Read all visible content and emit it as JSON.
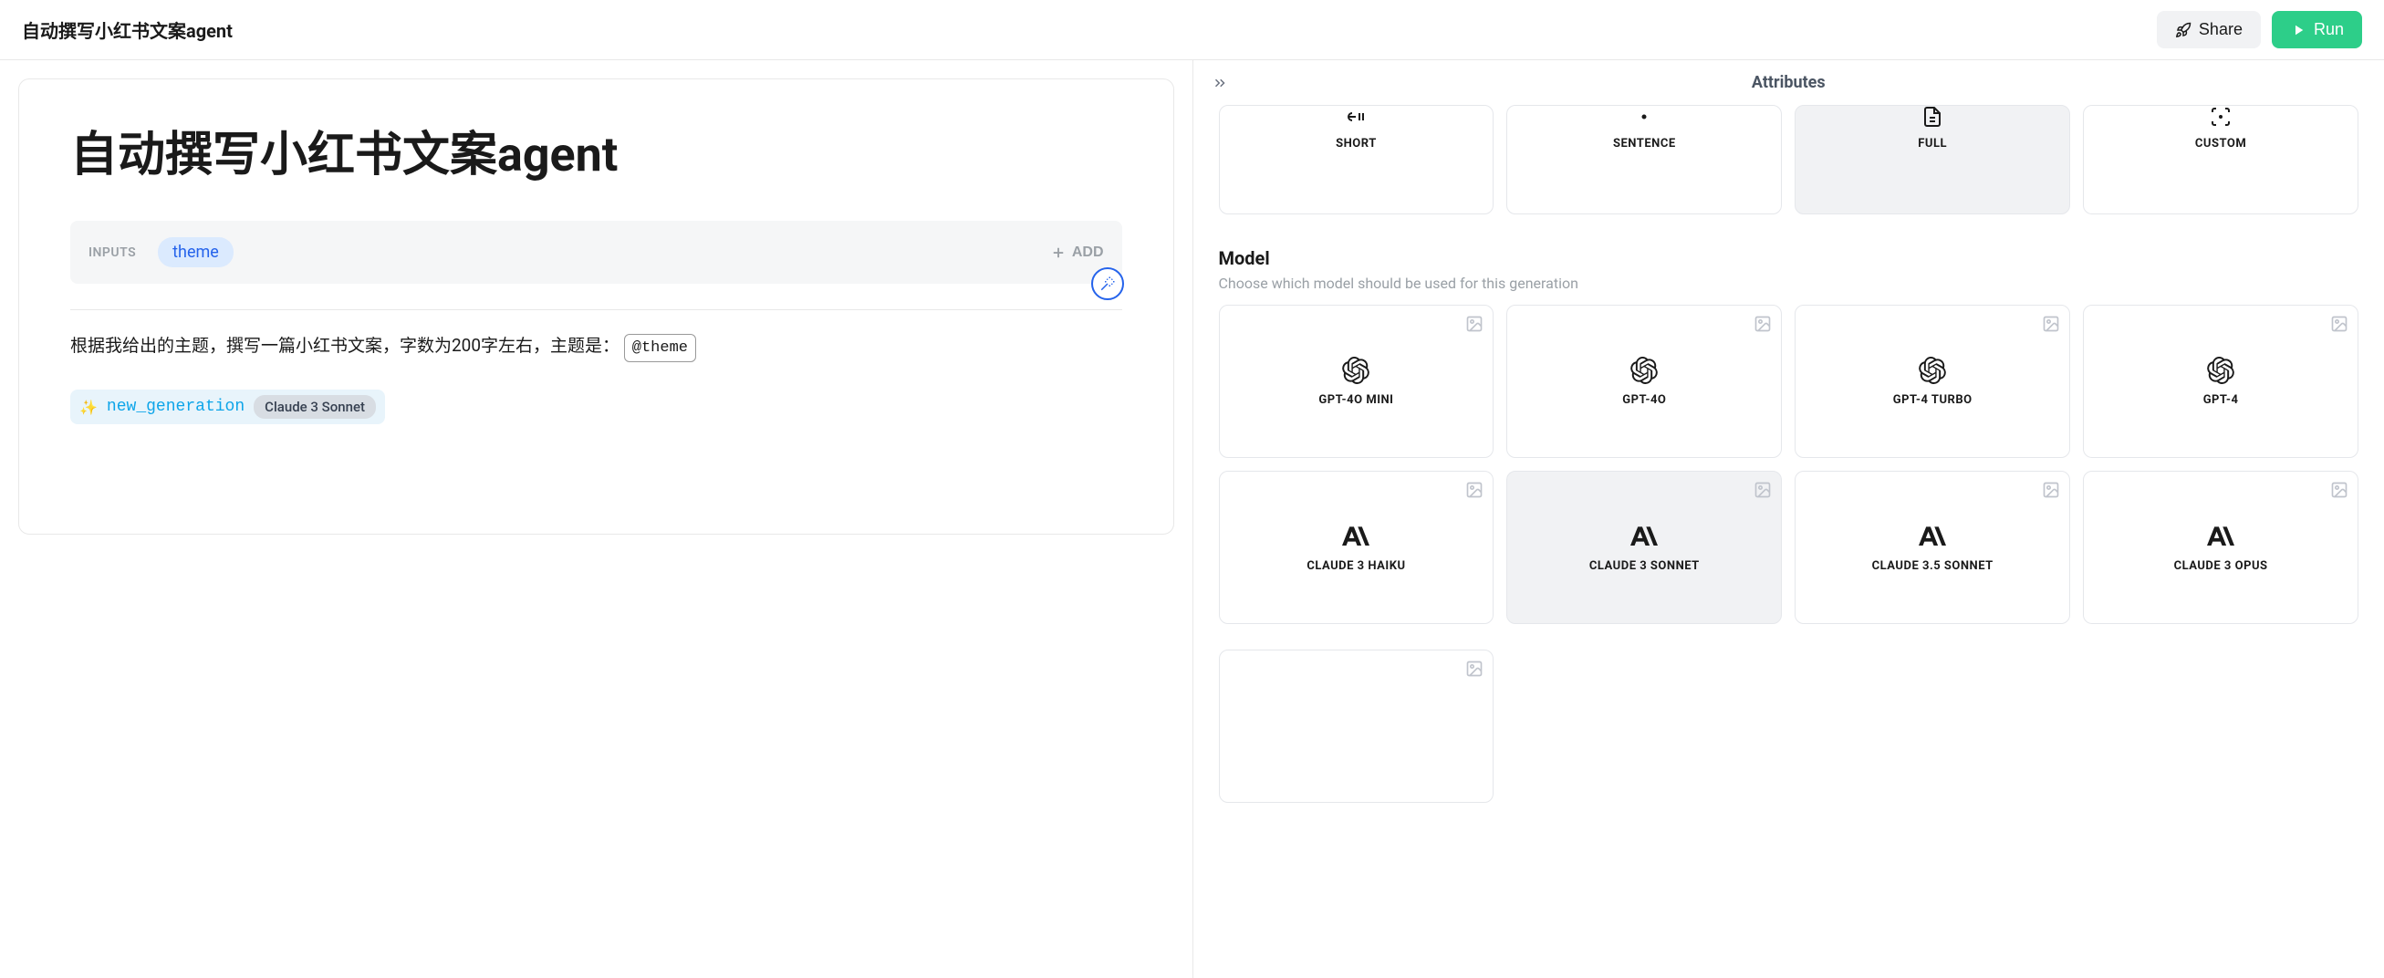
{
  "header": {
    "title": "自动撰写小红书文案agent",
    "share_label": "Share",
    "run_label": "Run"
  },
  "editor": {
    "title": "自动撰写小红书文案agent",
    "inputs_label": "INPUTS",
    "input_chip": "theme",
    "add_label": "ADD",
    "prompt_prefix": "根据我给出的主题，撰写一篇小红书文案，字数为200字左右，主题是：",
    "prompt_var": "@theme",
    "generation_name": "new_generation",
    "generation_model": "Claude 3 Sonnet"
  },
  "attributes": {
    "panel_title": "Attributes",
    "length_options": [
      {
        "label": "SHORT",
        "selected": false
      },
      {
        "label": "SENTENCE",
        "selected": false
      },
      {
        "label": "FULL",
        "selected": true
      },
      {
        "label": "CUSTOM",
        "selected": false
      }
    ],
    "model_section": {
      "title": "Model",
      "description": "Choose which model should be used for this generation"
    },
    "models": [
      {
        "label": "GPT-4O MINI",
        "provider": "openai",
        "selected": false
      },
      {
        "label": "GPT-4O",
        "provider": "openai",
        "selected": false
      },
      {
        "label": "GPT-4 TURBO",
        "provider": "openai",
        "selected": false
      },
      {
        "label": "GPT-4",
        "provider": "openai",
        "selected": false
      },
      {
        "label": "CLAUDE 3 HAIKU",
        "provider": "anthropic",
        "selected": false
      },
      {
        "label": "CLAUDE 3 SONNET",
        "provider": "anthropic",
        "selected": true
      },
      {
        "label": "CLAUDE 3.5 SONNET",
        "provider": "anthropic",
        "selected": false
      },
      {
        "label": "CLAUDE 3 OPUS",
        "provider": "anthropic",
        "selected": false
      }
    ]
  }
}
